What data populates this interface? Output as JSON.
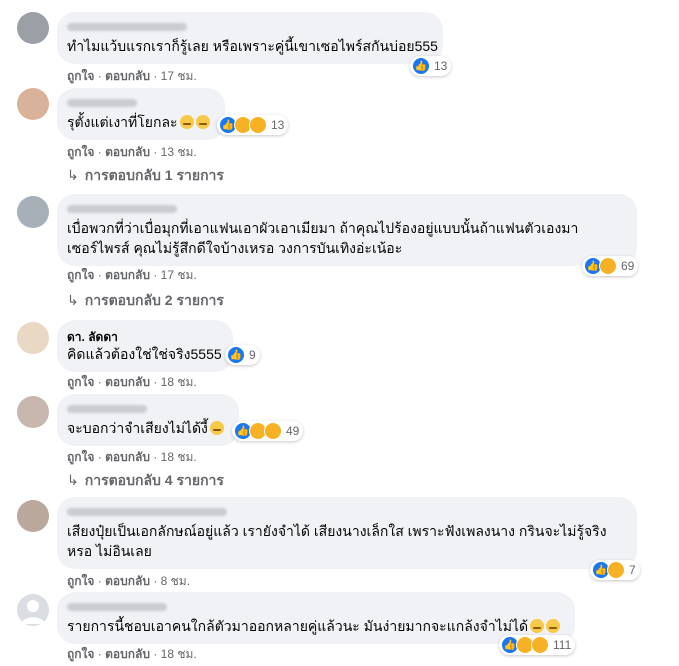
{
  "labels": {
    "like": "ถูกใจ",
    "reply": "ตอบกลับ",
    "sep": "·"
  },
  "comments": [
    {
      "author": "",
      "text_lines": [
        "ทำไมแว้บแรกเราก็รู้เลย หรือเพราะคู่นี้เขาเซอไพร์สกันบ่อย555"
      ],
      "reaction_count": "13",
      "time": "17 ชม.",
      "replies": ""
    },
    {
      "author": "",
      "text_lines": [
        "รุตั้งแต่เงาที่โยกละ"
      ],
      "reaction_count": "13",
      "time": "13 ชม.",
      "replies": "การตอบกลับ 1 รายการ"
    },
    {
      "author": "",
      "text_lines": [
        "เบื่อพวกที่ว่าเบื่อมุกที่เอาแฟนเอาผัวเอาเมียมา ถ้าคุณไปร้องอยู่แบบนั้นถ้าแฟนตัวเองมา",
        "เซอร์ไพรส์ คุณไม่รู้สึกดีใจบ้างเหรอ วงการบันเทิงอ่ะเน้อะ"
      ],
      "reaction_count": "69",
      "time": "17 ชม.",
      "replies": "การตอบกลับ 2 รายการ"
    },
    {
      "author": "ดา. ลัดดา",
      "text_lines": [
        "คิดแล้วต้องใช่ใช่จริง5555"
      ],
      "reaction_count": "9",
      "time": "18 ชม.",
      "replies": ""
    },
    {
      "author": "",
      "text_lines": [
        "จะบอกว่าจำเสียงไม่ได้งี้"
      ],
      "reaction_count": "49",
      "time": "18 ชม.",
      "replies": "การตอบกลับ 4 รายการ"
    },
    {
      "author": "",
      "text_lines": [
        "เสียงปุ๋ยเป็นเอกลักษณ์อยู่แล้ว เรายังจำได้ เสียงนางเล็กใส เพราะฟังเพลงนาง กรินจะไม่รู้จริง",
        "หรอ ไม่อินเลย"
      ],
      "reaction_count": "7",
      "time": "8 ชม.",
      "replies": ""
    },
    {
      "author": "",
      "text_lines": [
        "รายการนี้ชอบเอาคนใกล้ตัวมาออกหลายคู่แล้วนะ มันง่ายมากจะแกล้งจำไม่ได้"
      ],
      "reaction_count": "111",
      "time": "18 ชม.",
      "replies": ""
    }
  ]
}
